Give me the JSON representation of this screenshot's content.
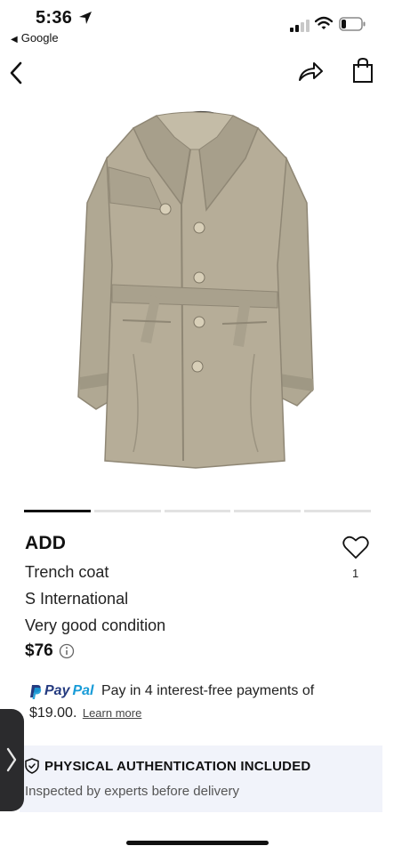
{
  "status_bar": {
    "time": "5:36",
    "back_app": "Google",
    "icons": [
      "location-arrow-icon",
      "cellular-signal-icon",
      "wifi-icon",
      "battery-icon"
    ]
  },
  "nav": {
    "icons": [
      "back-chevron-icon",
      "share-icon",
      "shopping-bag-icon"
    ]
  },
  "product": {
    "image_alt": "Trench coat photo",
    "carousel_count": 5,
    "carousel_active": 0,
    "brand": "ADD",
    "name": "Trench coat",
    "size": "S International",
    "condition": "Very good condition",
    "price": "$76",
    "likes": "1"
  },
  "paypal": {
    "logo_pay": "Pay",
    "logo_pal": "Pal",
    "text_line1": "Pay in 4 interest-free payments of",
    "amount": "$19.00.",
    "learn_more": "Learn more"
  },
  "auth": {
    "title": "PHYSICAL AUTHENTICATION INCLUDED",
    "subtitle": "Inspected by experts before delivery"
  },
  "colors": {
    "coat": "#b0a893",
    "coat_shadow": "#8f8775",
    "paypal_dark": "#253b80",
    "paypal_light": "#179bd7",
    "auth_bg": "#f1f3fa"
  }
}
